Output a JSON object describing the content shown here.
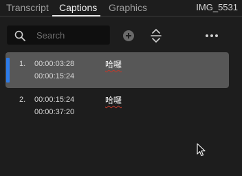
{
  "tabs": {
    "transcript": "Transcript",
    "captions": "Captions",
    "graphics": "Graphics"
  },
  "clip_name": "IMG_5531",
  "search": {
    "placeholder": "Search",
    "value": ""
  },
  "icons": {
    "search": "search-icon",
    "add": "add-circle-icon",
    "split": "split-caption-icon",
    "more": "more-options-icon",
    "cursor": "mouse-cursor-icon"
  },
  "colors": {
    "background": "#1d1d1d",
    "selected_row": "#575757",
    "selection_accent": "#2d7be8",
    "spell_underline": "#c0392b"
  },
  "captions": [
    {
      "index": "1.",
      "in": "00:00:03:28",
      "out": "00:00:15:24",
      "text": "哈囉",
      "selected": true
    },
    {
      "index": "2.",
      "in": "00:00:15:24",
      "out": "00:00:37:20",
      "text": "哈囉",
      "selected": false
    }
  ]
}
